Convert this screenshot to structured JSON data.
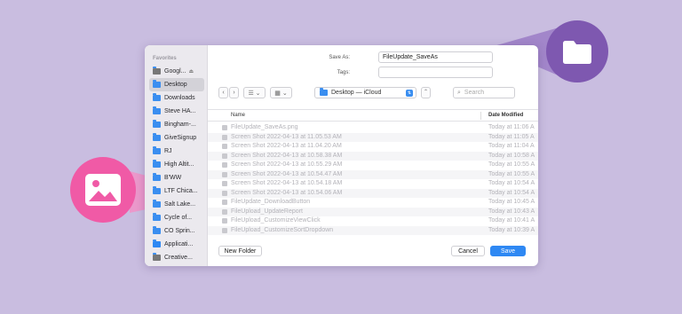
{
  "sidebar": {
    "heading": "Favorites",
    "items": [
      {
        "label": "Googl...",
        "icon": "drive-icon",
        "eject": "⏏"
      },
      {
        "label": "Desktop",
        "icon": "desktop-folder-icon"
      },
      {
        "label": "Downloads",
        "icon": "downloads-icon"
      },
      {
        "label": "Steve HA...",
        "icon": "folder-icon"
      },
      {
        "label": "Bingham-...",
        "icon": "folder-icon"
      },
      {
        "label": "GiveSignup",
        "icon": "folder-icon"
      },
      {
        "label": "RJ",
        "icon": "folder-icon"
      },
      {
        "label": "High Altit...",
        "icon": "folder-icon"
      },
      {
        "label": "B'WW",
        "icon": "folder-icon"
      },
      {
        "label": "LTF Chica...",
        "icon": "folder-icon"
      },
      {
        "label": "Salt Lake...",
        "icon": "folder-icon"
      },
      {
        "label": "Cycle of...",
        "icon": "folder-icon"
      },
      {
        "label": "CO Sprin...",
        "icon": "folder-icon"
      },
      {
        "label": "Applicati...",
        "icon": "applications-icon"
      },
      {
        "label": "Creative...",
        "icon": "document-icon"
      }
    ]
  },
  "save_as": {
    "label": "Save As:",
    "value": "FileUpdate_SaveAs"
  },
  "tags": {
    "label": "Tags:",
    "value": ""
  },
  "toolbar": {
    "location": "Desktop — iCloud",
    "search_placeholder": "Search"
  },
  "columns": {
    "name": "Name",
    "date": "Date Modified"
  },
  "files": [
    {
      "name": "FileUpdate_SaveAs.png",
      "date": "Today at 11:06 A"
    },
    {
      "name": "Screen Shot 2022-04-13 at 11.05.53 AM",
      "date": "Today at 11:05 A"
    },
    {
      "name": "Screen Shot 2022-04-13 at 11.04.20 AM",
      "date": "Today at 11:04 A"
    },
    {
      "name": "Screen Shot 2022-04-13 at 10.58.38 AM",
      "date": "Today at 10:58 A"
    },
    {
      "name": "Screen Shot 2022-04-13 at 10.55.29 AM",
      "date": "Today at 10:55 A"
    },
    {
      "name": "Screen Shot 2022-04-13 at 10.54.47 AM",
      "date": "Today at 10:55 A"
    },
    {
      "name": "Screen Shot 2022-04-13 at 10.54.18 AM",
      "date": "Today at 10:54 A"
    },
    {
      "name": "Screen Shot 2022-04-13 at 10.54.06 AM",
      "date": "Today at 10:54 A"
    },
    {
      "name": "FileUpdate_DownloadButton",
      "date": "Today at 10:45 A"
    },
    {
      "name": "FileUpload_UpdateReport",
      "date": "Today at 10:43 A"
    },
    {
      "name": "FileUpload_CustomizeViewClick",
      "date": "Today at 10:41 A"
    },
    {
      "name": "FileUpload_CustomizeSortDropdown",
      "date": "Today at 10:39 A"
    }
  ],
  "buttons": {
    "new_folder": "New Folder",
    "cancel": "Cancel",
    "save": "Save"
  },
  "colors": {
    "accent": "#2e88f3",
    "callout_folder": "#7e58b0",
    "callout_image": "#f05aa6",
    "background": "#c9bde0"
  }
}
